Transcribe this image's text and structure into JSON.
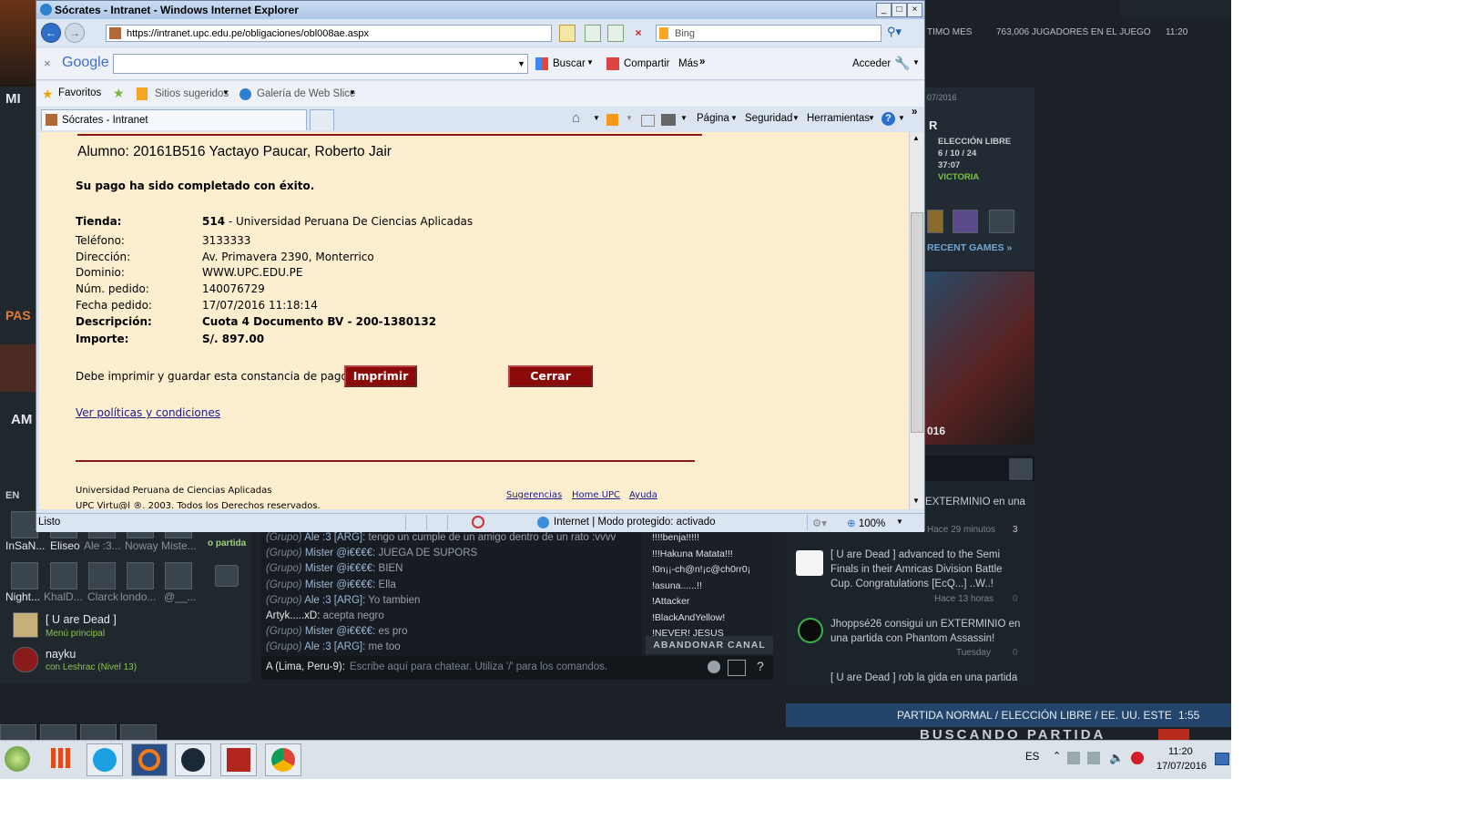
{
  "ie": {
    "window_title": "Sócrates - Intranet - Windows Internet Explorer",
    "url": "https://intranet.upc.edu.pe/obligaciones/obl008ae.aspx",
    "search_engine": "Bing",
    "google_label": "Google",
    "google_buttons": [
      "Buscar",
      "Compartir",
      "Más"
    ],
    "google_signin": "Acceder",
    "favorites": "Favoritos",
    "suggested_sites": "Sitios sugeridos",
    "web_slice": "Galería de Web Slice",
    "tab_title": "Sócrates - Intranet",
    "command_menus": [
      "Página",
      "Seguridad",
      "Herramientas"
    ],
    "status": "Listo",
    "zone": "Internet | Modo protegido: activado",
    "zoom": "100%"
  },
  "page": {
    "student": "Alumno: 20161B516  Yactayo Paucar, Roberto Jair",
    "success_msg": "Su pago ha sido completado con éxito.",
    "fields": [
      {
        "label": "Tienda:",
        "value_bold": "514",
        "value": " - Universidad Peruana De Ciencias Aplicadas"
      },
      {
        "label": "Teléfono:",
        "value": "3133333"
      },
      {
        "label": "Dirección:",
        "value": "Av. Primavera 2390, Monterrico"
      },
      {
        "label": "Dominio:",
        "value": "WWW.UPC.EDU.PE"
      },
      {
        "label": "Núm. pedido:",
        "value": "140076729"
      },
      {
        "label": "Fecha pedido:",
        "value": "17/07/2016 11:18:14"
      },
      {
        "label": "Descripción:",
        "value": "Cuota 4 Documento BV - 200-1380132"
      },
      {
        "label": "Importe:",
        "value": "S/. 897.00"
      }
    ],
    "print_prompt": "Debe imprimir y guardar esta constancia de pago:",
    "print_button": "Imprimir",
    "close_button": "Cerrar",
    "policies_link": "Ver políticas y condiciones",
    "footer_org": "Universidad Peruana de Ciencias Aplicadas",
    "footer_copy": "UPC Virtu@l ®. 2003. Todos los Derechos reservados.",
    "footer_links": [
      "Sugerencias",
      "Home UPC",
      "Ayuda"
    ]
  },
  "dota": {
    "top_stats": "763,006  JUGADORES EN EL JUEGO",
    "top_left": "TIMO MES",
    "clock": "11:20",
    "match_date": "07/2016",
    "match_mode": "ELECCIÓN LIBRE",
    "match_kda": "6 / 10 / 24",
    "match_time": "37:07",
    "match_result": "VICTORIA",
    "recent_games": "RECENT GAMES »",
    "year_label": "016",
    "section_mi": "MI",
    "section_pas": "PAS",
    "section_am": "AM",
    "section_en": "EN",
    "news": [
      {
        "text": "EXTERMINIO en una",
        "meta": "Hace 29 minutos",
        "count": "3"
      },
      {
        "text": "[ U are Dead ] advanced to the Semi Finals in their Amricas Division Battle Cup. Congratulations [EcQ...] ..W..!",
        "meta": "Hace 13 horas",
        "count": "0"
      },
      {
        "text": "Jhoppsé26 consigui un EXTERMINIO en una partida con Phantom Assassin!",
        "meta": "Tuesday",
        "count": "0"
      },
      {
        "text": "[ U are Dead ] rob la gida en una partida",
        "meta": "",
        "count": ""
      }
    ],
    "chat": [
      {
        "group": "(Grupo)",
        "name": "Ale :3 [ARG]:",
        "msg": "tengo un cumple de un amigo dentro de un rato :vvvv"
      },
      {
        "group": "(Grupo)",
        "name": "Mister @i€€€€:",
        "msg": "JUEGA DE SUPORS"
      },
      {
        "group": "(Grupo)",
        "name": "Mister @i€€€€:",
        "msg": "BIEN"
      },
      {
        "group": "(Grupo)",
        "name": "Mister @i€€€€:",
        "msg": "Ella"
      },
      {
        "group": "(Grupo)",
        "name": "Ale :3 [ARG]:",
        "msg": "Yo tambien"
      },
      {
        "group": "",
        "name": "Artyk.....xD:",
        "msg": "acepta negro"
      },
      {
        "group": "(Grupo)",
        "name": "Mister @i€€€€:",
        "msg": "es pro"
      },
      {
        "group": "(Grupo)",
        "name": "Ale :3 [ARG]:",
        "msg": "me too"
      }
    ],
    "channel_users": [
      "!!!!benja!!!!!",
      "!!!Hakuna Matata!!!",
      "!0n¡¡-ch@n!¡c@ch0rr0¡",
      "!asuna......!!",
      "!Attacker",
      "!BlackAndYellow!",
      "!NEVER! JESUS"
    ],
    "leave_channel": "ABANDONAR CANAL",
    "chat_channel": "A (Lima, Peru-9):",
    "chat_placeholder": "Escribe aquí para chatear. Utiliza '/' para los comandos.",
    "friends_row1": [
      "InSaN...",
      "Eliseo",
      "Ale :3...",
      "Noway",
      "Miste..."
    ],
    "friends_row2": [
      "Night...",
      "KhalD...",
      "Clarck",
      "londo...",
      "@__..."
    ],
    "party_label": "o partida",
    "friend_u_are_dead": "[ U are Dead ]",
    "friend_u_are_dead_status": "Menú principal",
    "friend_nayku": "nayku",
    "friend_nayku_status": "con Leshrac (Nivel 13)",
    "queue_info": "PARTIDA NORMAL / ELECCIÓN LIBRE / EE. UU. ESTE",
    "queue_time": "1:55",
    "searching": "BUSCANDO PARTIDA"
  },
  "taskbar": {
    "lang": "ES",
    "time": "11:20",
    "date": "17/07/2016"
  }
}
